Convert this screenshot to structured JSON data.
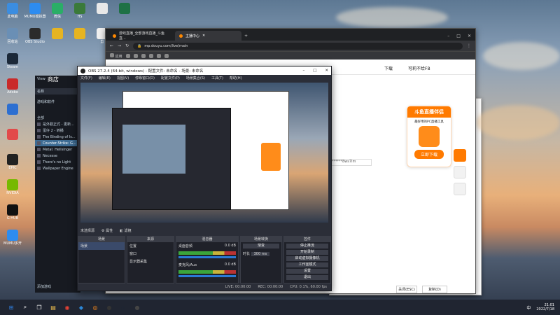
{
  "desktop_icons": [
    {
      "label": "此电脑",
      "color": "#3b8de0"
    },
    {
      "label": "MUMU模拟器",
      "color": "#2d8cf0"
    },
    {
      "label": "微信",
      "color": "#2aae67"
    },
    {
      "label": "HS",
      "color": "#3a7a3a"
    },
    {
      "label": "",
      "color": "#e8e8e8"
    },
    {
      "label": "",
      "color": "#1e7145"
    },
    {
      "label": "回收站",
      "color": "#6a8fb5"
    },
    {
      "label": "OBS Studio",
      "color": "#2b2b2b"
    },
    {
      "label": "",
      "color": "#e6b422"
    },
    {
      "label": "",
      "color": "#e6b422"
    },
    {
      "label": "剪",
      "color": "#f0f0f0"
    },
    {
      "label": "",
      "color": "#3d6fc6"
    },
    {
      "label": "Steam",
      "color": "#1b2838"
    },
    {
      "label": "Adobe",
      "color": "#c92a2a"
    },
    {
      "label": "",
      "color": "#2d6fd1"
    },
    {
      "label": "",
      "color": "#e24a4a"
    },
    {
      "label": "EPIC",
      "color": "#222"
    },
    {
      "label": "NVIDIA",
      "color": "#76b900"
    },
    {
      "label": "G HUB",
      "color": "#111"
    },
    {
      "label": "MUMU多开",
      "color": "#2d8cf0"
    }
  ],
  "taskbar": {
    "icons": [
      "windows-icon",
      "search-icon",
      "task-view-icon",
      "file-explorer-icon",
      "chrome-icon",
      "vscode-icon",
      "douyu-icon",
      "obs-icon",
      "steam-icon",
      "obs2-icon"
    ],
    "time": "21:01",
    "date": "2022/7/18",
    "lang": "中"
  },
  "chrome": {
    "tabs": [
      {
        "label": "游戏直播_全部游戏直播_斗鱼直..."
      },
      {
        "label": "主播中心"
      }
    ],
    "url": "mp.douyu.com/live/main",
    "bookmarks_label": "应用",
    "page": {
      "download_label": "下载",
      "user_label": "可莉不给FB",
      "promo_title": "斗鱼直播伴侣",
      "promo_sub": "最好用的PC直播工具",
      "promo_button": "立即下载",
      "stream_key_tail": "8ws7im",
      "close_label": "关闭(ESC)",
      "copy_label": "复制(D)"
    }
  },
  "steam": {
    "nav": [
      "View",
      "商店"
    ],
    "section": "游戏和软件",
    "group": "全部",
    "games": [
      "是外勤正式 - 更新...",
      "蛋仔 2 - 转播",
      "The Binding of Is...",
      "Counter-Strike: G...",
      "Metal: Hellsinger",
      "Necesse",
      "There's no Light",
      "Wallpaper Engine"
    ],
    "add_label": "添加游戏"
  },
  "obs": {
    "title": "OBS 27.2.4 (64-bit, windows) - 配置文件: 未命名 - 场景: 未命名",
    "menu": [
      "文件(F)",
      "编辑(E)",
      "视图(V)",
      "停靠窗口(D)",
      "配置文件(P)",
      "场景集合(S)",
      "工具(T)",
      "帮助(H)"
    ],
    "source_bar": [
      "未选择源",
      "属性",
      "滤镜"
    ],
    "docks": {
      "scenes": {
        "title": "场景",
        "items": [
          "场景"
        ]
      },
      "sources": {
        "title": "来源",
        "items": [
          "位置",
          "窗口",
          "显示器采集"
        ]
      },
      "mixer": {
        "title": "混音器",
        "items": [
          "桌面音频",
          "麦克风/Aux"
        ],
        "level": "0.0 dB"
      },
      "transitions": {
        "title": "场景转换",
        "mode": "渐变",
        "duration_label": "时长",
        "duration": "300 ms"
      },
      "controls": {
        "title": "控件",
        "buttons": [
          "停止推流",
          "开始录制",
          "启动虚拟摄像机",
          "工作室模式",
          "设置",
          "退出"
        ]
      }
    },
    "status": [
      "LIVE: 00:00:00",
      "REC: 00:00:00",
      "CPU: 0.1%, 60.00 fps"
    ]
  }
}
